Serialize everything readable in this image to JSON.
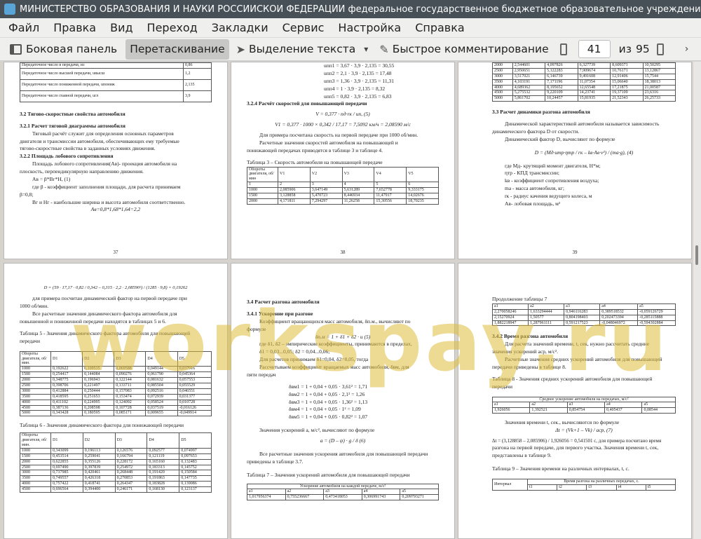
{
  "window": {
    "title": "МИНИСТЕРСТВО ОБРАЗОВАНИЯ И НАУКИ РОССИЙСКОЙ ФЕДЕРАЦИИ федеральное государственное бюджетное образовательное учреждение — Okular"
  },
  "menu": [
    "Файл",
    "Правка",
    "Вид",
    "Переход",
    "Закладки",
    "Сервис",
    "Настройка",
    "Справка"
  ],
  "toolbar": {
    "sidebar_label": "Боковая панель",
    "drag_label": "Перетаскивание",
    "select_label": "Выделение текста",
    "comment_label": "Быстрое комментирование",
    "page_current": "41",
    "page_of": "из",
    "page_total": "95"
  },
  "watermark": "workspay.ru",
  "pages": {
    "p1": {
      "table_rows": [
        [
          "Передаточное число в передачи, из",
          "0,86"
        ],
        [
          "Передаточное число высшей передачи, uвысш",
          "1,2"
        ],
        [
          "Передаточное число пониженной передачи, uпониж",
          "2,135"
        ],
        [
          "Передаточное число главной передачи, uгл",
          "3,9"
        ]
      ],
      "lines": [
        "3.2   Тягово-скоростные свойства автомобиля",
        "3.2.1 Расчет тяговой диаграммы автомобиля",
        "Тяговый расчёт служит для определения основных параметров",
        "двигателя и трансмиссии автомобиля, обеспечивающих ему требуемые",
        "тягово-скоростные свойства в заданных условиях движения.",
        "3.2.2 Площадь лобового сопротивления",
        "Площадь лобового сопротивления(Aв)- проекция автомобиля на",
        "плоскость, перпендикулярную направлению движения.",
        "Aв = β*Bг*H,                                                    (1)",
        "где β - коэффициент заполнения площади, для расчета принимаем",
        "β=0,8;",
        "Bг и Hг - наибольшие ширина и высота автомобиля соответственно.",
        "Aв=0,8*1,68*1,64=2,2"
      ],
      "page_num": "37"
    },
    "p2": {
      "lines": [
        "uпп1 = 3,67 · 3,9 · 2,135 = 30,55",
        "uпп2 = 2,1 · 3,9 · 2,135 = 17,48",
        "uпп3 = 1,36 · 3,9 · 2,135 = 11,31",
        "uпп4 =  1 · 3,9 · 2,135 =  8,32",
        "uпп5 = 0,82 · 3,9 · 2,135 = 6,83",
        "3.2.4 Расчёт скоростей для повышающей передачи",
        "V = 0,377 · nд·rк / uп,                                     (5)",
        "V1 = 0,377 · 1000 × 0,342 / 17,17 = 7,5092 км/ч = 2,08590 м/с",
        "Для примера посчитана скорость на первой передаче при 1000 об/мин.",
        "Расчетные значения скоростей автомобиля на повышающей и",
        "понижающей передачах приводятся в таблице 3 и таблице 4.",
        "Таблица 3 – Скорость автомобиля на повышающей передаче"
      ],
      "table_head": [
        "Обороты двигателя, об/мин",
        "V1",
        "V2",
        "V3",
        "V4",
        "V5"
      ],
      "table_sub": [
        "1",
        "2",
        "3",
        "4",
        "5",
        "6"
      ],
      "table_rows": [
        [
          "1000",
          "2,085906",
          "3,647149",
          "5,631289",
          "7,652778",
          "9,333175"
        ],
        [
          "1500",
          "3,128858",
          "5,470723",
          "8,446934",
          "11,47917",
          "14,02676"
        ],
        [
          "2000",
          "4,171811",
          "7,294297",
          "11,26258",
          "15,30556",
          "18,70235"
        ]
      ],
      "page_num": "38"
    },
    "p3": {
      "table_rows": [
        [
          "2000",
          "2,544601",
          "4,097826",
          "6,327739",
          "8,609371",
          "10,50295"
        ],
        [
          "2500",
          "2,950651",
          "5,122283",
          "7,909674",
          "10,76171",
          "13,12867"
        ],
        [
          "3000",
          "3,517021",
          "6,146739",
          "9,491608",
          "12,91406",
          "15,7544"
        ],
        [
          "3500",
          "4,103191",
          "7,171196",
          "11,07354",
          "15,06640",
          "18,38013"
        ],
        [
          "4000",
          "4,689362",
          "8,195652",
          "12,65548",
          "17,21875",
          "21,00587"
        ],
        [
          "4500",
          "5,275532",
          "9,220109",
          "14,23741",
          "19,37109",
          "23,6316"
        ],
        [
          "5000",
          "5,861702",
          "10,24457",
          "15,81935",
          "21,52343",
          "26,25733"
        ]
      ],
      "lines": [
        "3.3   Расчет динамики разгона автомобиля",
        "Динамической характеристикой автомобиля называется зависимость",
        "динамического фактора D от скорости.",
        "Динамический фактор D, вычисляют по формуле",
        "D = (Mд·uтр·ηтр / rк – kв·Aв·v²) / (mа·g),                (4)",
        "где Mд- крутящий момент двигателя, H*м;",
        "ηтр - КПД трансмиссии;",
        "kв - коэффициент сопротивления воздуха;",
        "mа - масса автомобиля, кг;",
        "rк - радиус качения ведущего колеса, м",
        "Aв- лобовая площадь, м²"
      ],
      "page_num": "39"
    },
    "p4": {
      "lines": [
        "D = (59 · 17,17 · 0,82 / 0,342 – 0,315 · 2,2 · 2,08590²) / (1285 · 9,8) = 0,19262",
        "для примера посчитан динамический фактор на первой передаче при",
        "1000 об/мин.",
        "Все расчетные значения динамического фактора автомобиля для",
        "повышенной и пониженной передачи находятся в таблицах 5 и 6.",
        "Таблица 5 - Значения динамического фактора автомобиля для повышающей",
        "передачи"
      ],
      "t5_head": [
        "Обороты двигателя, об/мин.",
        "D1",
        "D2",
        "D3",
        "D4",
        "D5"
      ],
      "t5_rows": [
        [
          "1000",
          "0,192622",
          "0,109535",
          "0,069588",
          "0,049144",
          "0,037916"
        ],
        [
          "1500",
          "0,254417",
          "0,144084",
          "0,090276",
          "0,061790",
          "0,045364"
        ],
        [
          "2000",
          "0,348775",
          "0,196943",
          "0,122144",
          "0,081632",
          "0,057553"
        ],
        [
          "2500",
          "0,398706",
          "0,221497",
          "0,133711",
          "0,085504",
          "0,055529"
        ],
        [
          "3000",
          "0,412884",
          "0,250444",
          "0,157083",
          "0,092516",
          "0,046551"
        ],
        [
          "3500",
          "0,418595",
          "0,251653",
          "0,153474",
          "0,072939",
          "0,031377"
        ],
        [
          "4000",
          "0,411102",
          "0,224995",
          "0,124092",
          "0,058524",
          "0,010728"
        ],
        [
          "4500",
          "0,387136",
          "0,208598",
          "0,107728",
          "0,037519",
          "-0,016126"
        ],
        [
          "5000",
          "0,343428",
          "0,180595",
          "0,085171",
          "0,009655",
          "-0,049914"
        ]
      ],
      "t6_title": "Таблица 6 - Значения динамического фактора для понижающей передачи",
      "t6_head": [
        "Обороты двигателя, об/мин.",
        "D1",
        "D2",
        "D3",
        "D4",
        "D5"
      ],
      "t6_rows": [
        [
          "1000",
          "0,343099",
          "0,196113",
          "0,126576",
          "0,092577",
          "0,074997"
        ],
        [
          "1500",
          "0,453514",
          "0,259041",
          "0,166794",
          "0,121119",
          "0,097653"
        ],
        [
          "2000",
          "0,622855",
          "0,355126",
          "0,228172",
          "0,165160",
          "0,132483"
        ],
        [
          "2500",
          "0,697490",
          "0,397839",
          "0,254972",
          "0,183313",
          "0,145752"
        ],
        [
          "3000",
          "0,737985",
          "0,420461",
          "0,268448",
          "0,191420",
          "0,150584"
        ],
        [
          "3500",
          "0,749557",
          "0,426318",
          "0,270853",
          "0,191863",
          "0,147735"
        ],
        [
          "4000",
          "0,757422",
          "0,418741",
          "0,264347",
          "0,183828",
          "0,139086"
        ],
        [
          "4500",
          "0,696564",
          "0,394400",
          "0,246171",
          "0,168130",
          "0,123137"
        ]
      ]
    },
    "p5": {
      "lines": [
        "3.4   Расчет разгона автомобиля",
        "3.4.1  Ускорение при разгоне",
        "Коэффициент вращающихся масс автомобиля, δп.м., вычисляют по",
        "формуле",
        "δп.м = 1 + δ1 + δ2 · u                                      (5)",
        "где δ1, δ2 – эмпирические коэффициенты, принимаются в пределах,",
        "δ1 = 0,03...0,05;  δ2 = 0,04...0,06;",
        "Для расчетов принимаем δ1=0,04, δ2=0,05, тогда",
        "Рассчитываем коэффициент вращаемых масс автомобиля, δвм, для",
        "пяти передач",
        "δвм1 = 1 + 0,04 + 0,05 · 3,61² = 1,71",
        "δвм2 = 1 + 0,04 + 0,05 · 2,1² = 1,26",
        "δвм3 = 1 + 0,04 + 0,05 · 1,36² = 1,13",
        "δвм4 = 1 + 0,04 + 0,05 · 1² = 1,09",
        "δвм5 = 1 + 0,04 + 0,05 · 0,82² = 1,07",
        "Значения ускорений a, м/с², вычисляют по формуле",
        "a = (D – ψ) · g / δ                                          (6)",
        "Все расчетные значения ускорения автомобиля для повышающей передачи",
        "приведены в таблице 3.7.",
        "Таблица 7 – Значения ускорений автомобиля для повышающей передачи"
      ],
      "t7_title": "Ускорение автомобиля на каждой передаче, м/с²",
      "t7_head": [
        "a1",
        "a2",
        "a3",
        "a4",
        "a5"
      ],
      "t7_row": [
        "1,017956374",
        "0,755236667",
        "0,473418053",
        "0,306991743",
        "0,209793271"
      ]
    },
    "p6": {
      "lines": [
        "Продолжение таблицы 7"
      ],
      "t7c_head": [
        "a1",
        "a2",
        "a3",
        "a4",
        "a5"
      ],
      "t7c_rows": [
        [
          "2,270058246",
          "1,633294444",
          "0,946116283",
          "0,389518532",
          "-0,059126729"
        ],
        [
          "2,15270924",
          "1,50577",
          "0,804198403",
          "0,202473394",
          "-0,285115888"
        ],
        [
          "1,882218947",
          "1,287961111",
          "0,591217523",
          "-0,048046972",
          "-0,594302884"
        ]
      ],
      "lines2": [
        "3.4.2 Время разгона автомобиля",
        "Для расчета значений времени, t, сек, нужно рассчитать средние",
        "значения ускорений aср, м/с².",
        "Расчетные значения средних ускорений автомобиля для повышающей",
        "передачи приведены в таблице 8.",
        "Таблица 8 - Значения средних ускорений автомобиля для повышающей",
        "передачи"
      ],
      "t8_title": "Среднее ускорение автомобиля на передачах, м/с²",
      "t8_head": [
        "a1",
        "a2",
        "a3",
        "a4",
        "a5"
      ],
      "t8_row": [
        "1,926056",
        "1,392521",
        "0,854754",
        "0,405437",
        "0,08544"
      ],
      "lines3": [
        "Значения времени t, сек., вычисляются по формуле",
        "Δt = (Vk+1 – Vk) / aср,                                   (7)",
        "Δt = (3,128858 – 2,085906) / 1,926056 = 0,541501  c, для примера посчитано время",
        "разгона на первой передаче, для первого участка. Значения времени t, сек,",
        "представлены в таблице 9.",
        "Таблица 9 – Значения времени на различных интервалах, t, c."
      ],
      "t9_title": "Время разгона на различных передачах, с.",
      "t9_head": [
        "Интервал",
        "t1",
        "t2",
        "t3",
        "t4",
        "t5"
      ]
    }
  }
}
